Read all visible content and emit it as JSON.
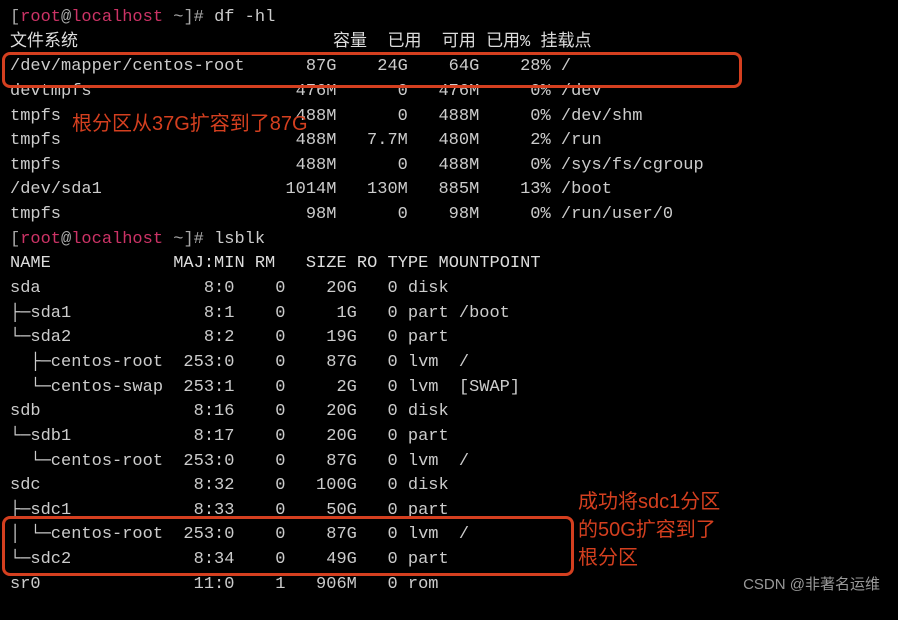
{
  "prompt1": {
    "open": "[",
    "user": "root",
    "at": "@",
    "host": "localhost",
    "path": " ~",
    "close": "]# ",
    "cmd": "df -hl"
  },
  "df": {
    "hdr": {
      "fs": "文件系统",
      "size": "容量",
      "used": "已用",
      "avail": "可用",
      "usep": "已用%",
      "mnt": "挂载点"
    },
    "rows": [
      {
        "fs": "/dev/mapper/centos-root",
        "size": "87G",
        "used": "24G",
        "avail": "64G",
        "usep": "28%",
        "mnt": "/"
      },
      {
        "fs": "devtmpfs",
        "size": "476M",
        "used": "0",
        "avail": "476M",
        "usep": "0%",
        "mnt": "/dev"
      },
      {
        "fs": "tmpfs",
        "size": "488M",
        "used": "0",
        "avail": "488M",
        "usep": "0%",
        "mnt": "/dev/shm"
      },
      {
        "fs": "tmpfs",
        "size": "488M",
        "used": "7.7M",
        "avail": "480M",
        "usep": "2%",
        "mnt": "/run"
      },
      {
        "fs": "tmpfs",
        "size": "488M",
        "used": "0",
        "avail": "488M",
        "usep": "0%",
        "mnt": "/sys/fs/cgroup"
      },
      {
        "fs": "/dev/sda1",
        "size": "1014M",
        "used": "130M",
        "avail": "885M",
        "usep": "13%",
        "mnt": "/boot"
      },
      {
        "fs": "tmpfs",
        "size": "98M",
        "used": "0",
        "avail": "98M",
        "usep": "0%",
        "mnt": "/run/user/0"
      }
    ]
  },
  "prompt2": {
    "open": "[",
    "user": "root",
    "at": "@",
    "host": "localhost",
    "path": " ~",
    "close": "]# ",
    "cmd": "lsblk"
  },
  "lsblk": {
    "hdr": {
      "name": "NAME",
      "mm": "MAJ:MIN",
      "rm": "RM",
      "size": "SIZE",
      "ro": "RO",
      "type": "TYPE",
      "mnt": "MOUNTPOINT"
    },
    "rows": [
      {
        "name": "sda",
        "maj": "8:0",
        "rm": "0",
        "size": "20G",
        "ro": "0",
        "type": "disk",
        "mnt": ""
      },
      {
        "name": "├─sda1",
        "maj": "8:1",
        "rm": "0",
        "size": "1G",
        "ro": "0",
        "type": "part",
        "mnt": "/boot"
      },
      {
        "name": "└─sda2",
        "maj": "8:2",
        "rm": "0",
        "size": "19G",
        "ro": "0",
        "type": "part",
        "mnt": ""
      },
      {
        "name": "  ├─centos-root",
        "maj": "253:0",
        "rm": "0",
        "size": "87G",
        "ro": "0",
        "type": "lvm",
        "mnt": "/"
      },
      {
        "name": "  └─centos-swap",
        "maj": "253:1",
        "rm": "0",
        "size": "2G",
        "ro": "0",
        "type": "lvm",
        "mnt": "[SWAP]"
      },
      {
        "name": "sdb",
        "maj": "8:16",
        "rm": "0",
        "size": "20G",
        "ro": "0",
        "type": "disk",
        "mnt": ""
      },
      {
        "name": "└─sdb1",
        "maj": "8:17",
        "rm": "0",
        "size": "20G",
        "ro": "0",
        "type": "part",
        "mnt": ""
      },
      {
        "name": "  └─centos-root",
        "maj": "253:0",
        "rm": "0",
        "size": "87G",
        "ro": "0",
        "type": "lvm",
        "mnt": "/"
      },
      {
        "name": "sdc",
        "maj": "8:32",
        "rm": "0",
        "size": "100G",
        "ro": "0",
        "type": "disk",
        "mnt": ""
      },
      {
        "name": "├─sdc1",
        "maj": "8:33",
        "rm": "0",
        "size": "50G",
        "ro": "0",
        "type": "part",
        "mnt": ""
      },
      {
        "name": "│ └─centos-root",
        "maj": "253:0",
        "rm": "0",
        "size": "87G",
        "ro": "0",
        "type": "lvm",
        "mnt": "/"
      },
      {
        "name": "└─sdc2",
        "maj": "8:34",
        "rm": "0",
        "size": "49G",
        "ro": "0",
        "type": "part",
        "mnt": ""
      },
      {
        "name": "sr0",
        "maj": "11:0",
        "rm": "1",
        "size": "906M",
        "ro": "0",
        "type": "rom",
        "mnt": ""
      }
    ]
  },
  "anno1": "根分区从37G扩容到了87G",
  "anno2_l1": "成功将sdc1分区",
  "anno2_l2": "的50G扩容到了",
  "anno2_l3": "根分区",
  "watermark": "CSDN @非著名运维"
}
